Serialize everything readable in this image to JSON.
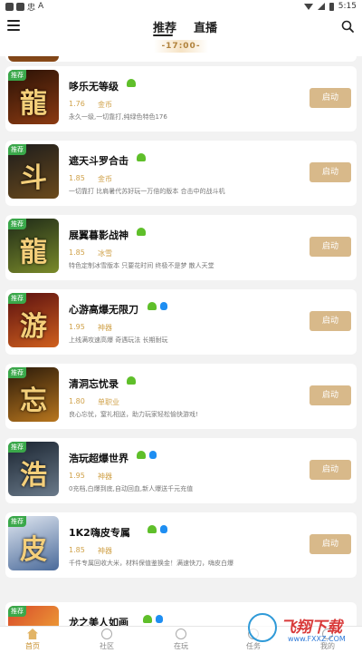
{
  "status_bar": {
    "glyph1": "忠",
    "glyph2": "A",
    "time": "5:15"
  },
  "header": {
    "tabs": [
      {
        "label": "推荐"
      },
      {
        "label": "直播"
      }
    ],
    "time_badge": "-17:00-"
  },
  "game_list": [
    {
      "name": "哆乐无等级",
      "version": "1.76",
      "tag": "金币",
      "desc": "永久一级,一切靠打,纯绿色特色176",
      "thumb_text": "龍",
      "thumb_colors": [
        "#2a1206",
        "#8b3a12"
      ],
      "has_apple": false
    },
    {
      "name": "遮天斗罗合击",
      "version": "1.85",
      "tag": "金币",
      "desc": "一切靠打 比肩暑代苏好玩一万倍的版本 合击中的战斗机",
      "thumb_text": "斗",
      "thumb_colors": [
        "#1c1c1c",
        "#6b4a1c"
      ],
      "has_apple": false
    },
    {
      "name": "展翼暮影战神",
      "version": "1.85",
      "tag": "冰雪",
      "desc": "特色定制冰雪版本 只要花时间 终极不是梦 散人天堂",
      "thumb_text": "龍",
      "thumb_colors": [
        "#1e2a18",
        "#7a8a2a"
      ],
      "has_apple": false
    },
    {
      "name": "心游高爆无限刀",
      "version": "1.95",
      "tag": "神器",
      "desc": "上线满攻速高爆 奇遇玩法 长期耐玩",
      "thumb_text": "游",
      "thumb_colors": [
        "#5a1010",
        "#d0601e"
      ],
      "has_apple": true
    },
    {
      "name": "清洞忘忧录",
      "version": "1.80",
      "tag": "单职业",
      "desc": "良心忘忧，窒礼相送，助力玩家轻松愉快游戏!",
      "thumb_text": "忘",
      "thumb_colors": [
        "#2a1a0a",
        "#b8761e"
      ],
      "has_apple": false
    },
    {
      "name": "浩玩超爆世界",
      "version": "1.95",
      "tag": "神器",
      "desc": "0充档,白爆到底,自动回血,新人爆送千元充值",
      "thumb_text": "浩",
      "thumb_colors": [
        "#1a2430",
        "#6a7a8a"
      ],
      "has_apple": true
    },
    {
      "name": "1K2嗨皮专属",
      "version": "1.85",
      "tag": "神器",
      "desc": "千件专属回收大米，材料保值鉴换金！满速快刀，嗨皮白爆",
      "thumb_text": "皮",
      "thumb_colors": [
        "#dfe6f0",
        "#4a6a9a"
      ],
      "has_apple": true
    }
  ],
  "start_label": "启动",
  "rec_badge": "推荐",
  "last_item": {
    "name": "龙之美人如画"
  },
  "bottom_nav": [
    {
      "label": "首页",
      "active": true
    },
    {
      "label": "社区",
      "active": false
    },
    {
      "label": "在玩",
      "active": false
    },
    {
      "label": "任务",
      "active": false
    },
    {
      "label": "我的",
      "active": false
    }
  ],
  "watermark": {
    "title": "飞翔下载",
    "sub": "www.FXXZ.COM"
  }
}
